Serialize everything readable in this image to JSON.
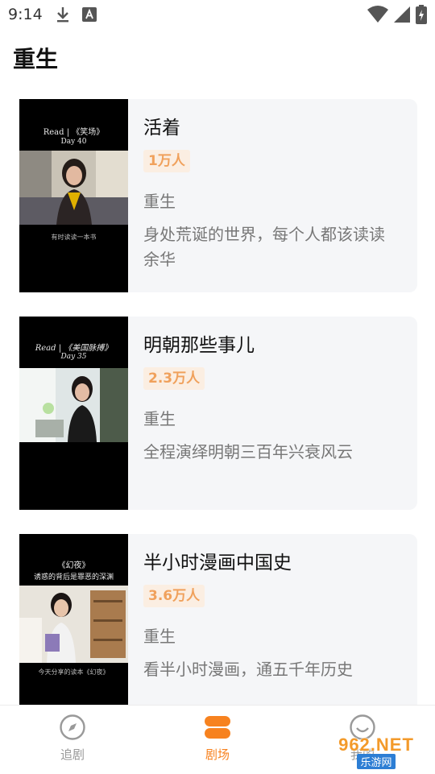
{
  "status_bar": {
    "time": "9:14"
  },
  "page": {
    "title": "重生"
  },
  "cards": [
    {
      "title": "活着",
      "popularity": "1万人",
      "tag": "重生",
      "description": "身处荒诞的世界，每个人都该读读余华",
      "thumb_top": "Read | 《笑场》",
      "thumb_sub": "Day 40",
      "thumb_bottom": "有时读读一本书"
    },
    {
      "title": "明朝那些事儿",
      "popularity": "2.3万人",
      "tag": "重生",
      "description": "全程演绎明朝三百年兴衰风云",
      "thumb_top": "Read | 《美国脉搏》",
      "thumb_sub": "Day 35",
      "thumb_bottom": ""
    },
    {
      "title": "半小时漫画中国史",
      "popularity": "3.6万人",
      "tag": "重生",
      "description": "看半小时漫画，通五千年历史",
      "thumb_top": "《幻夜》",
      "thumb_sub": "诱惑的背后是罪恶的深渊",
      "thumb_bottom": "今天分享的读本《幻夜》"
    }
  ],
  "bottom_nav": {
    "items": [
      {
        "label": "追剧",
        "icon": "compass-icon",
        "active": false
      },
      {
        "label": "剧场",
        "icon": "theater-icon",
        "active": true
      },
      {
        "label": "我的",
        "icon": "smiley-icon",
        "active": false
      }
    ]
  },
  "watermark": {
    "top": "962.NET",
    "bottom": "乐游网"
  },
  "colors": {
    "accent": "#f7821f",
    "badge_bg": "#fbeee2",
    "badge_text": "#f0a15c",
    "card_bg": "#f5f6f8"
  }
}
